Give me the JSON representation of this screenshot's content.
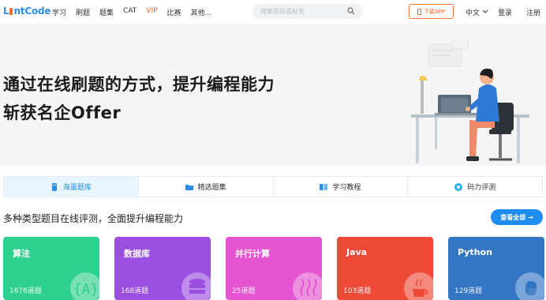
{
  "brand": {
    "logo_part1": "L",
    "logo_part2": "ntCode"
  },
  "nav": {
    "items": [
      {
        "label": "学习"
      },
      {
        "label": "刷题"
      },
      {
        "label": "题集"
      },
      {
        "label": "CAT"
      },
      {
        "label": "VIP"
      },
      {
        "label": "比赛"
      },
      {
        "label": "其他..."
      }
    ]
  },
  "search": {
    "placeholder": "搜索题目或标签"
  },
  "header_right": {
    "download": "下载APP",
    "language": "中文",
    "login": "登录",
    "register": "注册"
  },
  "hero": {
    "line1": "通过在线刷题的方式，提升编程能力",
    "line2": "斩获名企Offer"
  },
  "tabs": [
    {
      "label": "海量题库",
      "active": true,
      "color": "#2a8df0"
    },
    {
      "label": "精选题集",
      "active": false,
      "color": "#2a8df0"
    },
    {
      "label": "学习教程",
      "active": false,
      "color": "#2a8df0"
    },
    {
      "label": "码力评测",
      "active": false,
      "color": "#2ab0f0"
    }
  ],
  "section": {
    "title": "多种类型题目在线评测，全面提升编程能力",
    "view_all": "查看全部 →"
  },
  "cards": [
    {
      "name": "算法",
      "count": "1676道题",
      "color": "#2fcf8f",
      "icon": "braces-icon"
    },
    {
      "name": "数据库",
      "count": "168道题",
      "color": "#9b4fe0",
      "icon": "database-icon"
    },
    {
      "name": "并行计算",
      "count": "25道题",
      "color": "#e455cf",
      "icon": "waves-icon"
    },
    {
      "name": "Java",
      "count": "103道题",
      "color": "#ee4a38",
      "icon": "java-cup-icon"
    },
    {
      "name": "Python",
      "count": "129道题",
      "color": "#3476c4",
      "icon": "python-icon"
    }
  ]
}
